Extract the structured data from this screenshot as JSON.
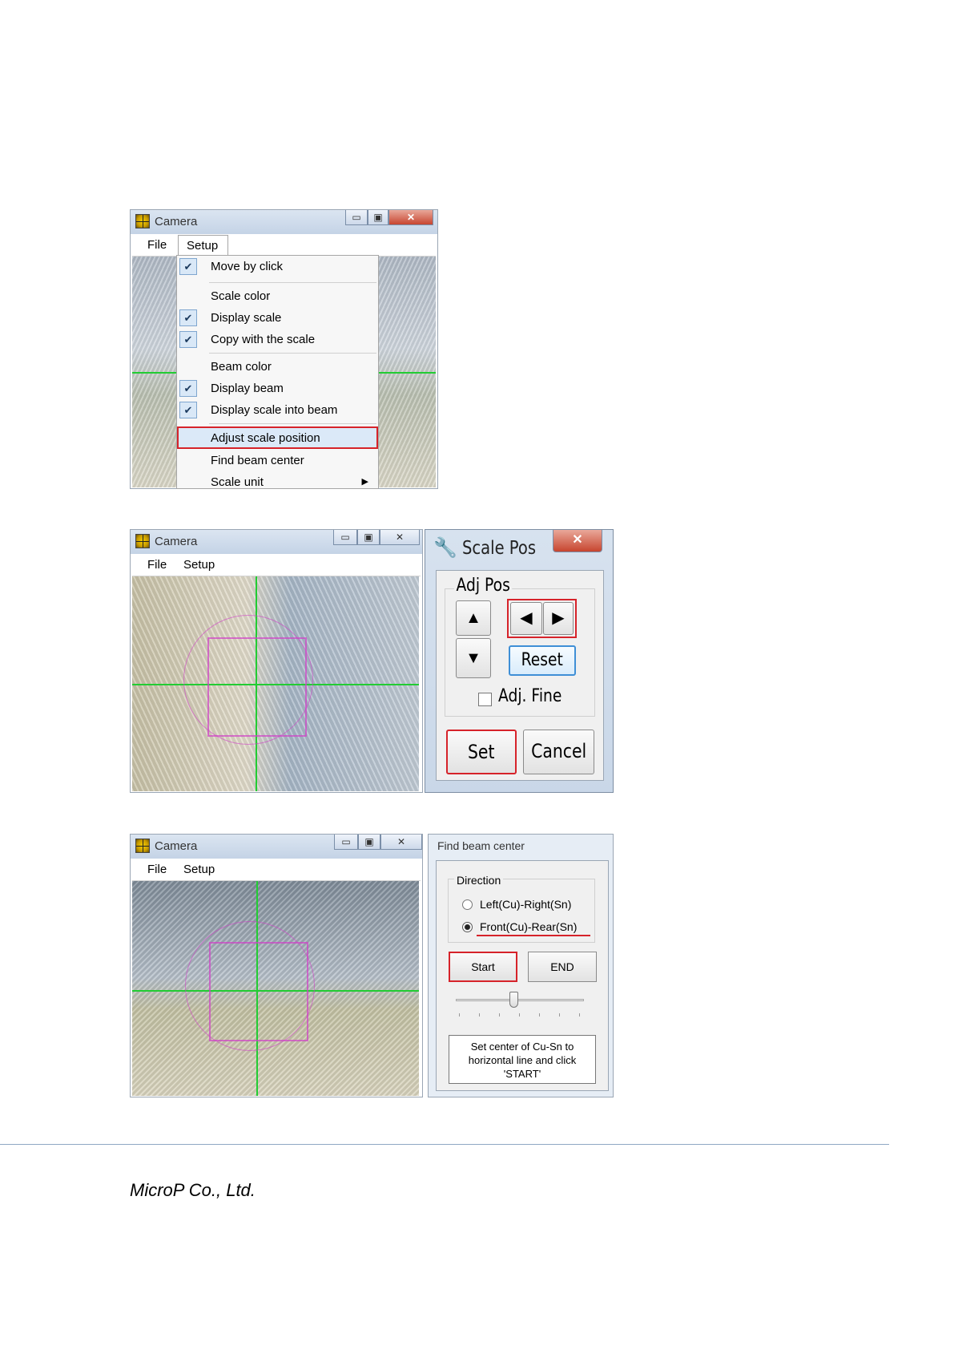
{
  "window1": {
    "title": "Camera",
    "menu": [
      "File",
      "Setup"
    ],
    "dropdown": [
      {
        "label": "Move by click",
        "checked": true
      },
      {
        "label": "Scale color",
        "checked": false
      },
      {
        "label": "Display scale",
        "checked": true
      },
      {
        "label": "Copy with the scale",
        "checked": true
      },
      {
        "label": "Beam color",
        "checked": false
      },
      {
        "label": "Display beam",
        "checked": true
      },
      {
        "label": "Display scale into beam",
        "checked": true
      },
      {
        "label": "Adjust scale position",
        "checked": false,
        "highlighted": true
      },
      {
        "label": "Find beam center",
        "checked": false
      },
      {
        "label": "Scale unit",
        "checked": false,
        "submenu": true
      }
    ]
  },
  "window2": {
    "title": "Camera",
    "menu": [
      "File",
      "Setup"
    ],
    "dialog": {
      "title": "Scale Pos",
      "group": "Adj Pos",
      "up_icon": "arrow-up-icon",
      "down_icon": "arrow-down-icon",
      "left_icon": "arrow-left-icon",
      "right_icon": "arrow-right-icon",
      "reset": "Reset",
      "fine": "Adj. Fine",
      "set": "Set",
      "cancel": "Cancel"
    }
  },
  "window3": {
    "title": "Camera",
    "menu": [
      "File",
      "Setup"
    ],
    "dialog": {
      "title": "Find beam center",
      "group": "Direction",
      "options": [
        {
          "label": "Left(Cu)-Right(Sn)",
          "selected": false
        },
        {
          "label": "Front(Cu)-Rear(Sn)",
          "selected": true
        }
      ],
      "start": "Start",
      "end": "END",
      "slider_value": 0.45,
      "message_line1": "Set center of Cu-Sn to",
      "message_line2": "horizontal line and click",
      "message_line3": "'START'"
    }
  },
  "footer": {
    "company": "MicroP Co., Ltd."
  },
  "colors": {
    "highlight": "#d6232a",
    "beam": "#22cc33",
    "scale": "#d040c8"
  }
}
